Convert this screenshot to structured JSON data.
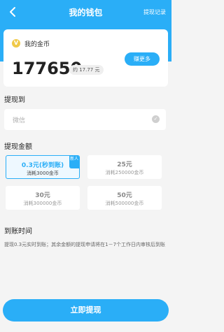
{
  "header": {
    "title": "我的钱包",
    "record_link": "提现记录",
    "back_icon": "back-arrow-icon"
  },
  "wallet": {
    "coin_label": "我的金币",
    "coin_icon_glyph": "V",
    "balance": "177650",
    "approx": "约 17.77 元",
    "earn_button": "赚更多"
  },
  "withdraw_to": {
    "section_title": "提现到",
    "value": "微信"
  },
  "amount": {
    "section_title": "提现金额",
    "options": [
      {
        "amount": "0.3元(秒到账)",
        "cost": "消耗3000金币",
        "tag": "新人",
        "selected": true
      },
      {
        "amount": "25元",
        "cost": "消耗250000金币"
      },
      {
        "amount": "30元",
        "cost": "消耗300000金币"
      },
      {
        "amount": "50元",
        "cost": "消耗500000金币"
      }
    ]
  },
  "arrival": {
    "section_title": "到账时间",
    "notice": "提现0.3元实时到账；其余金额的提现申请将在1－7个工作日内审核后到账"
  },
  "footer": {
    "withdraw_button": "立即提现"
  },
  "colors": {
    "accent": "#2aaef7",
    "coin": "#f0c948"
  }
}
